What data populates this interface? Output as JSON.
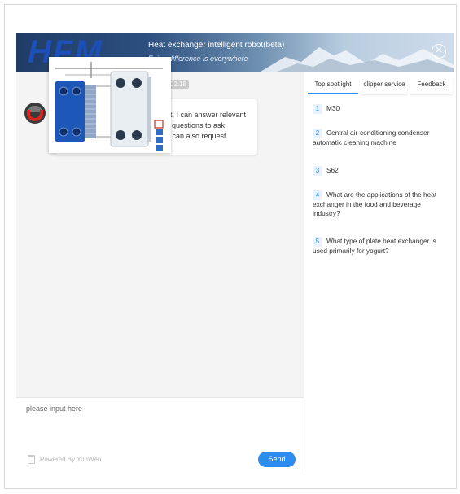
{
  "header": {
    "logo": "HFM",
    "title": "Heat exchanger intelligent robot(beta)",
    "subtitle": "Enjoy difference is everywhere"
  },
  "chat": {
    "timestamp": "02:18",
    "bubble_lines": [
      "ot, I can answer relevant",
      "y questions to ask",
      "u can also request"
    ]
  },
  "input": {
    "placeholder": "please input here",
    "powered_by": "Powered By YunWen",
    "send_label": "Send"
  },
  "tabs": [
    "Top spotlight",
    "clipper service",
    "Feedback"
  ],
  "questions": [
    {
      "num": "1",
      "text": "M30"
    },
    {
      "num": "2",
      "text": "Central air-conditioning condenser automatic cleaning machine"
    },
    {
      "num": "3",
      "text": "S62"
    },
    {
      "num": "4",
      "text": "What are the applications of the heat exchanger in the food and beverage industry?"
    },
    {
      "num": "5",
      "text": "What type of plate heat exchanger is used primarily for yogurt?"
    }
  ],
  "colors": {
    "accent": "#2d8cf0",
    "header_dark": "#1f3c66",
    "avatar_red": "#d9251d"
  }
}
